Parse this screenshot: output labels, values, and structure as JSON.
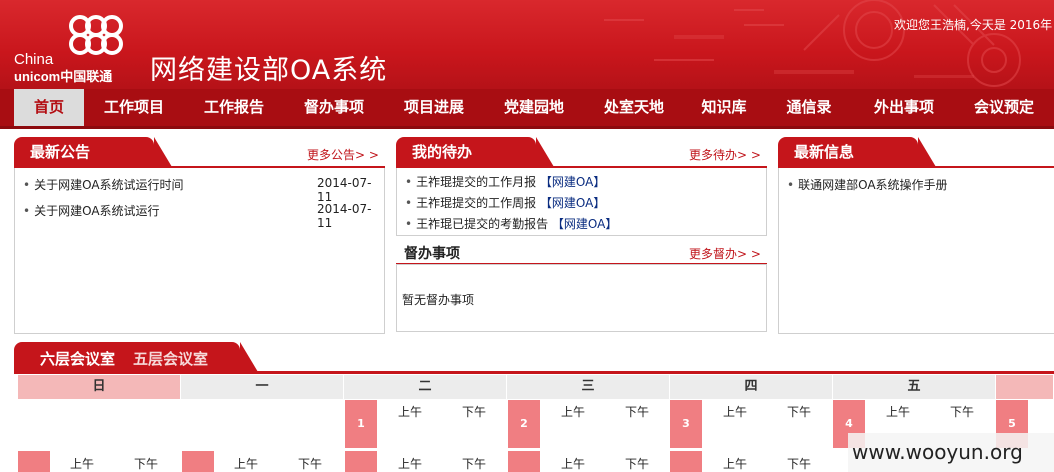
{
  "header": {
    "brand_en_1": "China",
    "brand_en_2": "unicom",
    "brand_cn": "中国联通",
    "system_title": "网络建设部OA系统",
    "welcome": "欢迎您王浩楠,今天是  2016年",
    "colors": {
      "primary": "#c9161c",
      "nav": "#a80d12"
    }
  },
  "nav": {
    "items": [
      "首页",
      "工作项目",
      "工作报告",
      "督办事项",
      "项目进展",
      "党建园地",
      "处室天地",
      "知识库",
      "通信录",
      "外出事项",
      "会议预定"
    ]
  },
  "announcements": {
    "title": "最新公告",
    "more": "更多公告> >",
    "items": [
      {
        "text": "关于网建OA系统试运行时间",
        "date": "2014-07-11"
      },
      {
        "text": "关于网建OA系统试运行",
        "date": "2014-07-11"
      }
    ]
  },
  "todo": {
    "title": "我的待办",
    "more": "更多待办> >",
    "items": [
      {
        "text": "王祚琨提交的工作月报",
        "tag": "【网建OA】"
      },
      {
        "text": "王祚琨提交的工作周报",
        "tag": "【网建OA】"
      },
      {
        "text": "王祚琨已提交的考勤报告",
        "tag": "【网建OA】"
      }
    ],
    "supervise_title": "督办事项",
    "supervise_more": "更多督办> >",
    "supervise_empty": "暂无督办事项"
  },
  "news": {
    "title": "最新信息",
    "items": [
      {
        "text": "联通网建部OA系统操作手册"
      }
    ]
  },
  "meeting": {
    "tab_6f": "六层会议室",
    "tab_5f": "五层会议室",
    "weekdays": [
      "日",
      "一",
      "二",
      "三",
      "四",
      "五"
    ],
    "am": "上午",
    "pm": "下午",
    "row1_days": [
      "1",
      "2",
      "3",
      "4",
      "5"
    ]
  },
  "watermark": "www.wooyun.org"
}
